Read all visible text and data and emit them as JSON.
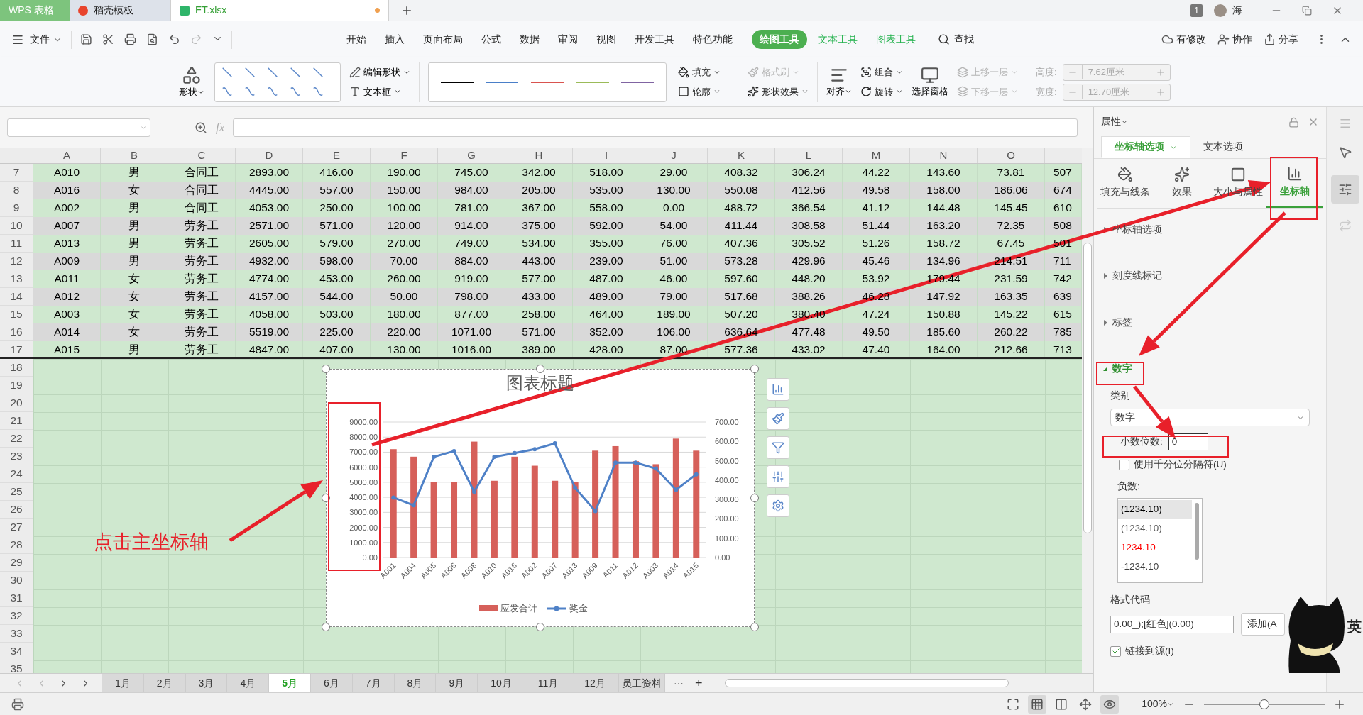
{
  "app_tabs": [
    {
      "label": "WPS 表格",
      "kind": "app",
      "selected": false
    },
    {
      "label": "稻壳模板",
      "kind": "template",
      "selected": false
    },
    {
      "label": "ET.xlsx",
      "kind": "sheet",
      "selected": true,
      "modified": true
    }
  ],
  "title_bar": {
    "badge": "1",
    "user": "海"
  },
  "menu": {
    "file": "文件",
    "items": [
      {
        "label": "开始",
        "kind": "normal",
        "selected": false
      },
      {
        "label": "插入",
        "kind": "normal",
        "selected": false
      },
      {
        "label": "页面布局",
        "kind": "normal",
        "selected": false
      },
      {
        "label": "公式",
        "kind": "normal",
        "selected": false
      },
      {
        "label": "数据",
        "kind": "normal",
        "selected": false
      },
      {
        "label": "审阅",
        "kind": "normal",
        "selected": false
      },
      {
        "label": "视图",
        "kind": "normal",
        "selected": false
      },
      {
        "label": "开发工具",
        "kind": "normal",
        "selected": false
      },
      {
        "label": "特色功能",
        "kind": "normal",
        "selected": false
      },
      {
        "label": "绘图工具",
        "kind": "context",
        "selected": true
      },
      {
        "label": "文本工具",
        "kind": "context",
        "selected": false
      },
      {
        "label": "图表工具",
        "kind": "context",
        "selected": false
      }
    ],
    "search": "查找",
    "actions": [
      "有修改",
      "协作",
      "分享"
    ]
  },
  "ribbon": {
    "shape": "形状",
    "edit_shape": "编辑形状",
    "text_box": "文本框",
    "line_styles": [
      {
        "color": "#000000"
      },
      {
        "color": "#4a7fc8"
      },
      {
        "color": "#d9534f"
      },
      {
        "color": "#9bbb59"
      },
      {
        "color": "#8064a2"
      }
    ],
    "fill": {
      "label": "填充",
      "disabled": false
    },
    "format_painter": {
      "label": "格式刷",
      "disabled": true
    },
    "outline": {
      "label": "轮廓",
      "disabled": false
    },
    "shape_effect": {
      "label": "形状效果",
      "disabled": false
    },
    "align": "对齐",
    "group": {
      "label": "组合",
      "disabled": false
    },
    "rotate": {
      "label": "旋转",
      "disabled": false
    },
    "selection_pane": "选择窗格",
    "bring_forward": {
      "label": "上移一层",
      "disabled": true
    },
    "send_backward": {
      "label": "下移一层",
      "disabled": true
    },
    "size": [
      {
        "label": "高度:",
        "value": "7.62厘米",
        "disabled": true
      },
      {
        "label": "宽度:",
        "value": "12.70厘米",
        "disabled": true
      }
    ]
  },
  "formula_bar": {
    "function_label": "fx"
  },
  "sheet": {
    "columns": [
      "A",
      "B",
      "C",
      "D",
      "E",
      "F",
      "G",
      "H",
      "I",
      "J",
      "K",
      "L",
      "M",
      "N",
      "O"
    ],
    "rows": [
      {
        "number": "7",
        "cells": [
          "A010",
          "男",
          "合同工",
          "2893.00",
          "416.00",
          "190.00",
          "745.00",
          "342.00",
          "518.00",
          "29.00",
          "408.32",
          "306.24",
          "44.22",
          "143.60",
          "73.81",
          "507"
        ]
      },
      {
        "number": "8",
        "cells": [
          "A016",
          "女",
          "合同工",
          "4445.00",
          "557.00",
          "150.00",
          "984.00",
          "205.00",
          "535.00",
          "130.00",
          "550.08",
          "412.56",
          "49.58",
          "158.00",
          "186.06",
          "674"
        ]
      },
      {
        "number": "9",
        "cells": [
          "A002",
          "男",
          "合同工",
          "4053.00",
          "250.00",
          "100.00",
          "781.00",
          "367.00",
          "558.00",
          "0.00",
          "488.72",
          "366.54",
          "41.12",
          "144.48",
          "145.45",
          "610"
        ]
      },
      {
        "number": "10",
        "cells": [
          "A007",
          "男",
          "劳务工",
          "2571.00",
          "571.00",
          "120.00",
          "914.00",
          "375.00",
          "592.00",
          "54.00",
          "411.44",
          "308.58",
          "51.44",
          "163.20",
          "72.35",
          "508"
        ]
      },
      {
        "number": "11",
        "cells": [
          "A013",
          "男",
          "劳务工",
          "2605.00",
          "579.00",
          "270.00",
          "749.00",
          "534.00",
          "355.00",
          "76.00",
          "407.36",
          "305.52",
          "51.26",
          "158.72",
          "67.45",
          "501"
        ]
      },
      {
        "number": "12",
        "cells": [
          "A009",
          "男",
          "劳务工",
          "4932.00",
          "598.00",
          "70.00",
          "884.00",
          "443.00",
          "239.00",
          "51.00",
          "573.28",
          "429.96",
          "45.46",
          "134.96",
          "214.51",
          "711"
        ]
      },
      {
        "number": "13",
        "cells": [
          "A011",
          "女",
          "劳务工",
          "4774.00",
          "453.00",
          "260.00",
          "919.00",
          "577.00",
          "487.00",
          "46.00",
          "597.60",
          "448.20",
          "53.92",
          "179.44",
          "231.59",
          "742"
        ]
      },
      {
        "number": "14",
        "cells": [
          "A012",
          "女",
          "劳务工",
          "4157.00",
          "544.00",
          "50.00",
          "798.00",
          "433.00",
          "489.00",
          "79.00",
          "517.68",
          "388.26",
          "46.28",
          "147.92",
          "163.35",
          "639"
        ]
      },
      {
        "number": "15",
        "cells": [
          "A003",
          "女",
          "劳务工",
          "4058.00",
          "503.00",
          "180.00",
          "877.00",
          "258.00",
          "464.00",
          "189.00",
          "507.20",
          "380.40",
          "47.24",
          "150.88",
          "145.22",
          "615"
        ]
      },
      {
        "number": "16",
        "cells": [
          "A014",
          "女",
          "劳务工",
          "5519.00",
          "225.00",
          "220.00",
          "1071.00",
          "571.00",
          "352.00",
          "106.00",
          "636.64",
          "477.48",
          "49.50",
          "185.60",
          "260.22",
          "785"
        ]
      },
      {
        "number": "17",
        "cells": [
          "A015",
          "男",
          "劳务工",
          "4847.00",
          "407.00",
          "130.00",
          "1016.00",
          "389.00",
          "428.00",
          "87.00",
          "577.36",
          "433.02",
          "47.40",
          "164.00",
          "212.66",
          "713"
        ]
      }
    ],
    "empty_rows": [
      "18",
      "19",
      "20",
      "21",
      "22",
      "23",
      "24",
      "25",
      "26",
      "27",
      "28",
      "29",
      "30",
      "31",
      "32",
      "33",
      "34",
      "35"
    ]
  },
  "chart": {
    "chart_data": {
      "type": "bar",
      "title": "图表标题",
      "categories": [
        "A001",
        "A004",
        "A005",
        "A006",
        "A008",
        "A010",
        "A016",
        "A002",
        "A007",
        "A013",
        "A009",
        "A011",
        "A012",
        "A003",
        "A014",
        "A015"
      ],
      "series": [
        {
          "name": "应发合计",
          "color": "#d6605a",
          "values": [
            7200,
            6700,
            5000,
            5000,
            7700,
            5100,
            6700,
            6100,
            5100,
            5000,
            7100,
            7400,
            6400,
            6200,
            7900,
            7100
          ]
        }
      ],
      "grid": true,
      "ylim": [
        0,
        9000
      ],
      "yticks": [
        {
          "value": 0,
          "label": "0.00"
        },
        {
          "value": 1000,
          "label": "1000.00"
        },
        {
          "value": 2000,
          "label": "2000.00"
        },
        {
          "value": 3000,
          "label": "3000.00"
        },
        {
          "value": 4000,
          "label": "4000.00"
        },
        {
          "value": 5000,
          "label": "5000.00"
        },
        {
          "value": 6000,
          "label": "6000.00"
        },
        {
          "value": 7000,
          "label": "7000.00"
        },
        {
          "value": 8000,
          "label": "8000.00"
        },
        {
          "value": 9000,
          "label": "9000.00"
        }
      ]
    },
    "line_overlay": {
      "chart_data": {
        "type": "line",
        "series": [
          {
            "name": "奖金",
            "color": "#4f81c7",
            "marker": true,
            "values": [
              310,
              270,
              520,
              550,
              340,
              520,
              540,
              560,
              590,
              360,
              240,
              490,
              490,
              460,
              350,
              430
            ]
          }
        ],
        "ylim": [
          0,
          700
        ],
        "yticks": [
          {
            "value": 0,
            "label": "0.00"
          },
          {
            "value": 100,
            "label": "100.00"
          },
          {
            "value": 200,
            "label": "200.00"
          },
          {
            "value": 300,
            "label": "300.00"
          },
          {
            "value": 400,
            "label": "400.00"
          },
          {
            "value": 500,
            "label": "500.00"
          },
          {
            "value": 600,
            "label": "600.00"
          },
          {
            "value": 700,
            "label": "700.00"
          }
        ]
      }
    }
  },
  "panel": {
    "title": "属性",
    "tabs": [
      {
        "label": "坐标轴选项",
        "selected": true
      },
      {
        "label": "文本选项",
        "selected": false
      }
    ],
    "icon_tabs": [
      {
        "label": "填充与线条",
        "selected": false
      },
      {
        "label": "效果",
        "selected": false
      },
      {
        "label": "大小与属性",
        "selected": false
      },
      {
        "label": "坐标轴",
        "selected": true
      }
    ],
    "sections": [
      {
        "label": "坐标轴选项",
        "expanded": false
      },
      {
        "label": "刻度线标记",
        "expanded": false
      },
      {
        "label": "标签",
        "expanded": false
      },
      {
        "label": "数字",
        "expanded": true
      }
    ],
    "category_label": "类别",
    "category_value": "数字",
    "decimals_label": "小数位数:",
    "decimals_value": "0",
    "thousands": {
      "label": "使用千分位分隔符(U)",
      "checked": false
    },
    "negative_label": "负数:",
    "negative_formats": [
      {
        "label": "(1234.10)",
        "color": "#000000",
        "selected": true
      },
      {
        "label": "(1234.10)",
        "color": "#595959",
        "selected": false
      },
      {
        "label": "1234.10",
        "color": "#ff0000",
        "selected": false
      },
      {
        "label": "-1234.10",
        "color": "#404040",
        "selected": false
      }
    ],
    "format_code_label": "格式代码",
    "format_code": "0.00_);[红色](0.00)",
    "add_button": "添加(A",
    "link_source": {
      "label": "链接到源(I)",
      "checked": true
    }
  },
  "sheet_tabs": {
    "tabs": [
      {
        "label": "1月",
        "selected": false
      },
      {
        "label": "2月",
        "selected": false
      },
      {
        "label": "3月",
        "selected": false
      },
      {
        "label": "4月",
        "selected": false
      },
      {
        "label": "5月",
        "selected": true
      },
      {
        "label": "6月",
        "selected": false
      },
      {
        "label": "7月",
        "selected": false
      },
      {
        "label": "8月",
        "selected": false
      },
      {
        "label": "9月",
        "selected": false
      },
      {
        "label": "10月",
        "selected": false
      },
      {
        "label": "11月",
        "selected": false
      },
      {
        "label": "12月",
        "selected": false
      },
      {
        "label": "员工资料",
        "selected": false
      }
    ],
    "more": "···",
    "add": "+"
  },
  "status_bar": {
    "zoom": "100%",
    "zoom_slider": {
      "level": 0.5
    }
  },
  "annotation": {
    "callout": "点击主坐标轴"
  },
  "ime": "英"
}
